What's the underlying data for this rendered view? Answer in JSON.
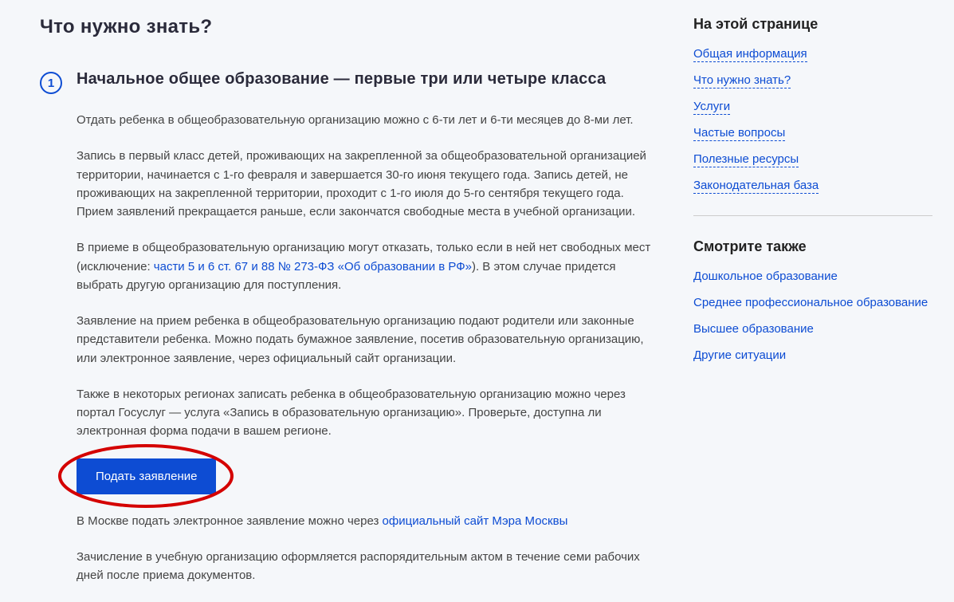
{
  "main": {
    "title": "Что нужно знать?",
    "step_number": "1",
    "heading": "Начальное общее образование — первые три или четыре класса",
    "p1": "Отдать ребенка в общеобразовательную организацию можно с 6-ти лет и 6-ти месяцев до 8-ми лет.",
    "p2": "Запись в первый класс детей, проживающих на закрепленной за общеобразовательной организацией территории, начинается с 1-го февраля и завершается 30-го июня текущего года. Запись детей, не проживающих на закрепленной территории, проходит с 1-го июля до 5-го сентября текущего года. Прием заявлений прекращается раньше, если закончатся свободные места в учебной организации.",
    "p3_a": "В приеме в общеобразовательную организацию могут отказать, только если в ней нет свободных мест (исключение: ",
    "p3_link": "части 5 и 6 ст. 67 и 88 № 273-ФЗ «Об образовании в РФ»",
    "p3_b": "). В этом случае придется выбрать другую организацию для поступления.",
    "p4": "Заявление на прием ребенка в общеобразовательную организацию подают родители или законные представители ребенка. Можно подать бумажное заявление, посетив образовательную организацию, или электронное заявление, через официальный сайт организации.",
    "p5": "Также в некоторых регионах записать ребенка в общеобразовательную организацию можно через портал Госуслуг — услуга «Запись в образовательную организацию». Проверьте, доступна ли электронная форма подачи в вашем регионе.",
    "button": "Подать заявление",
    "p6_a": "В Москве подать электронное заявление можно через ",
    "p6_link": "официальный сайт Мэра Москвы",
    "p7": "Зачисление в учебную организацию оформляется распорядительным актом в течение семи рабочих дней после приема документов."
  },
  "sidebar": {
    "nav_title": "На этой странице",
    "nav_items": [
      "Общая информация",
      "Что нужно знать?",
      "Услуги",
      "Частые вопросы",
      "Полезные ресурсы",
      "Законодательная база"
    ],
    "related_title": "Смотрите также",
    "related_items": [
      "Дошкольное образование",
      "Среднее профессиональное образование",
      "Высшее образование",
      "Другие ситуации"
    ]
  }
}
